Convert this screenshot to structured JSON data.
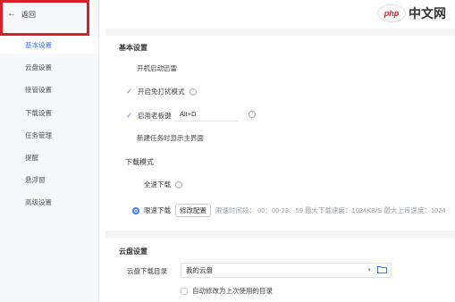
{
  "back_label": "返回",
  "sidebar": {
    "items": [
      {
        "label": "基本设置",
        "active": true
      },
      {
        "label": "云盘设置"
      },
      {
        "label": "接管设置"
      },
      {
        "label": "下载设置"
      },
      {
        "label": "任务管理"
      },
      {
        "label": "提醒"
      },
      {
        "label": "悬浮窗"
      },
      {
        "label": "高级设置"
      }
    ]
  },
  "basic": {
    "title": "基本设置",
    "auto_start": "开机启动迅雷",
    "no_disturb": "开启免打扰模式",
    "boss_key": "启用老板键",
    "boss_key_value": "Alt+D",
    "show_main": "新建任务时显示主界面"
  },
  "download_mode": {
    "title": "下载模式",
    "full_speed": "全速下载",
    "limited": "限速下载",
    "edit_button": "修改配置",
    "limit_info": "限速时间段：  00：00-23：59   最大下载速度：1024KB/S   最大上传速度：1024"
  },
  "cloud": {
    "title": "云盘设置",
    "dir_label": "云盘下载目录",
    "dir_value": "我的云盘",
    "auto_change": "自动修改为上次使用的目录"
  },
  "watermark": {
    "logo": "php",
    "text": "中文网"
  },
  "colors": {
    "accent": "#3a7afe",
    "highlight": "#d9202a"
  }
}
